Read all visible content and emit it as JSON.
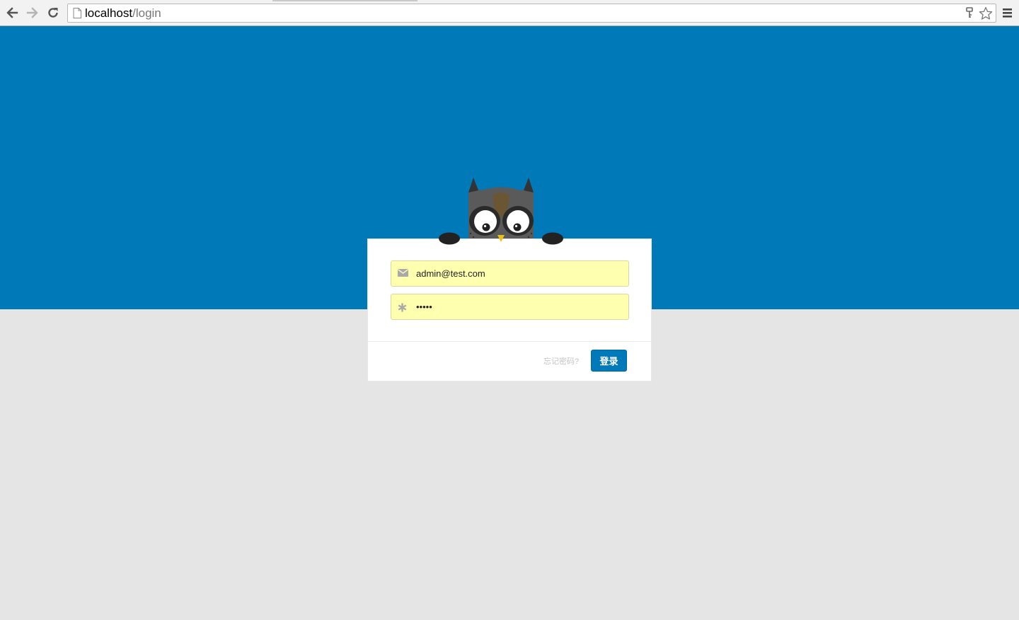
{
  "browser": {
    "url_host": "localhost",
    "url_path": "/login"
  },
  "colors": {
    "brand": "#0079b9",
    "background": "#e5e5e5",
    "autofill": "#ffffb0"
  },
  "login": {
    "email_value": "admin@test.com",
    "password_value": "abcde",
    "forgot_label": "忘记密码?",
    "submit_label": "登录"
  },
  "icons": {
    "email": "envelope-icon",
    "password": "asterisk-icon",
    "mascot": "owl-mascot"
  }
}
